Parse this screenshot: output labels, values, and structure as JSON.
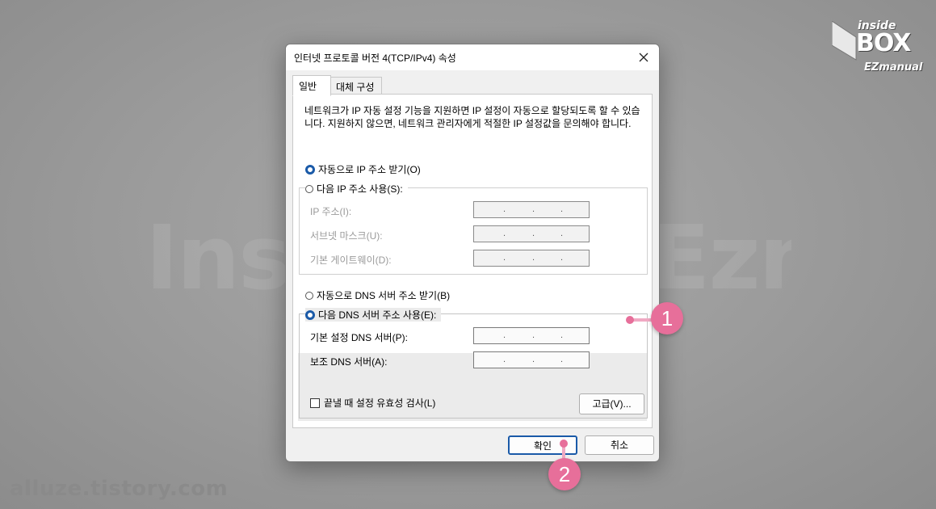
{
  "watermark": {
    "background_text": "InsideBox Ezmanual",
    "footer_url": "alluze.tistory.com"
  },
  "logo": {
    "top": "inside",
    "main": "BOX",
    "bottom": "EZmanual"
  },
  "dialog": {
    "title": "인터넷 프로토콜 버전 4(TCP/IPv4) 속성",
    "tabs": [
      "일반",
      "대체 구성"
    ],
    "description": "네트워크가 IP 자동 설정 기능을 지원하면 IP 설정이 자동으로 할당되도록 할 수 있습니다. 지원하지 않으면, 네트워크 관리자에게 적절한 IP 설정값을 문의해야 합니다.",
    "ip_auto_label": "자동으로 IP 주소 받기(O)",
    "ip_manual_label": "다음 IP 주소 사용(S):",
    "ip_fields": [
      {
        "label": "IP 주소(I):",
        "value": ". . ."
      },
      {
        "label": "서브넷 마스크(U):",
        "value": ". . ."
      },
      {
        "label": "기본 게이트웨이(D):",
        "value": ". . ."
      }
    ],
    "dns_auto_label": "자동으로 DNS 서버 주소 받기(B)",
    "dns_manual_label": "다음 DNS 서버 주소 사용(E):",
    "dns_fields": [
      {
        "label": "기본 설정 DNS 서버(P):",
        "value": ". . ."
      },
      {
        "label": "보조 DNS 서버(A):",
        "value": ". . ."
      }
    ],
    "validate_label": "끝낼 때 설정 유효성 검사(L)",
    "advanced_button": "고급(V)...",
    "ok_button": "확인",
    "cancel_button": "취소",
    "ip_auto_selected": true,
    "dns_manual_selected": true,
    "validate_checked": false
  },
  "callouts": {
    "first": "1",
    "second": "2"
  },
  "colors": {
    "accent": "#1a5aa8",
    "callout": "#e76f9a"
  }
}
